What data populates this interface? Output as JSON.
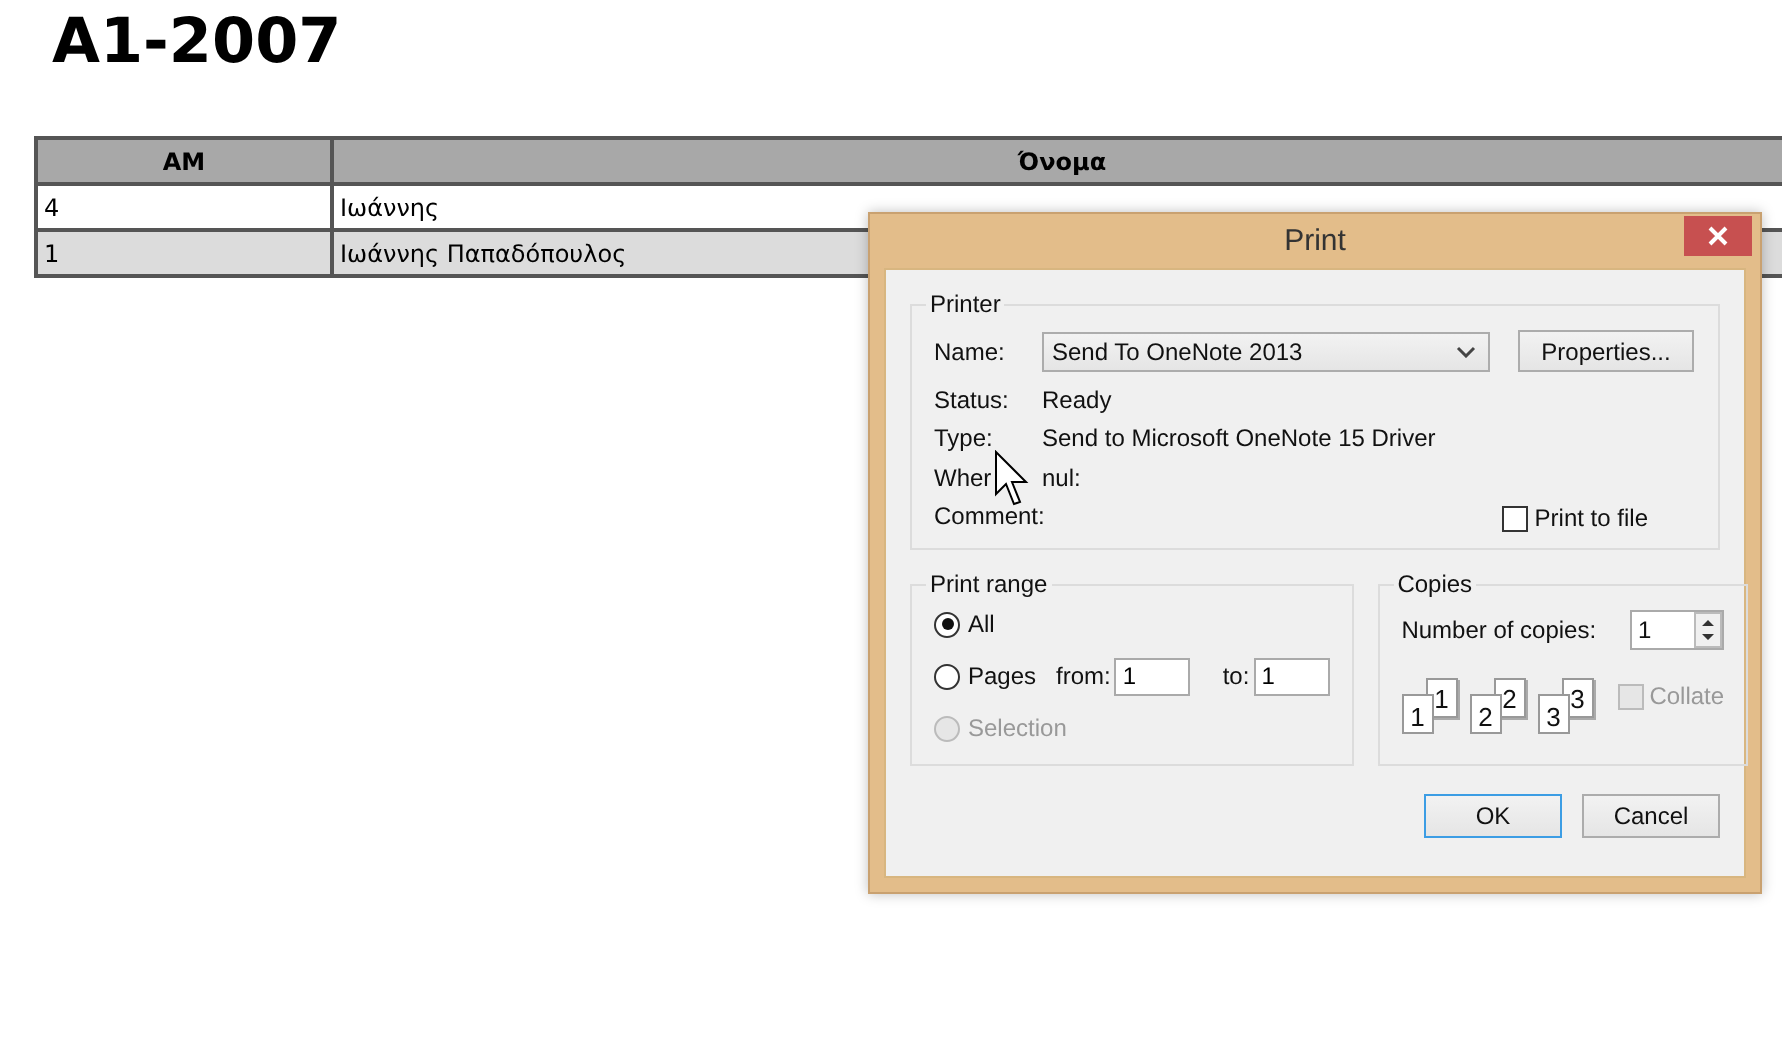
{
  "heading": "A1-2007",
  "table": {
    "columns": [
      "AM",
      "Όνομα"
    ],
    "rows": [
      [
        "4",
        "Ιωάννης"
      ],
      [
        "1",
        "Ιωάννης Παπαδόπουλος"
      ]
    ]
  },
  "dialog": {
    "title": "Print",
    "printer": {
      "legend": "Printer",
      "name_label": "Name:",
      "name_value": "Send To OneNote 2013",
      "properties": "Properties...",
      "info": [
        {
          "label": "Status:",
          "value": "Ready"
        },
        {
          "label": "Type:",
          "value": "Send to Microsoft OneNote 15 Driver"
        },
        {
          "label": "Wher",
          "value": "nul:"
        },
        {
          "label": "Comment:"
        }
      ],
      "print_to_file": {
        "label": "Print to file",
        "checked": false
      }
    },
    "print_range": {
      "legend": "Print range",
      "options": [
        {
          "label": "All",
          "selected": true,
          "disabled": false
        },
        {
          "label": "Pages",
          "selected": false,
          "disabled": false,
          "range": {
            "from_label": "from:",
            "from_value": "1",
            "to_label": "to:",
            "to_value": "1"
          }
        },
        {
          "label": "Selection",
          "selected": false,
          "disabled": true
        }
      ]
    },
    "copies": {
      "legend": "Copies",
      "count_label": "Number of copies:",
      "count_value": "1",
      "collate_pages": [
        {
          "back": "1",
          "front": "1"
        },
        {
          "back": "2",
          "front": "2"
        },
        {
          "back": "3",
          "front": "3"
        }
      ],
      "collate": {
        "label": "Collate",
        "checked": false,
        "disabled": true
      }
    },
    "buttons": [
      {
        "label": "OK",
        "default": true
      },
      {
        "label": "Cancel",
        "default": false
      }
    ]
  }
}
